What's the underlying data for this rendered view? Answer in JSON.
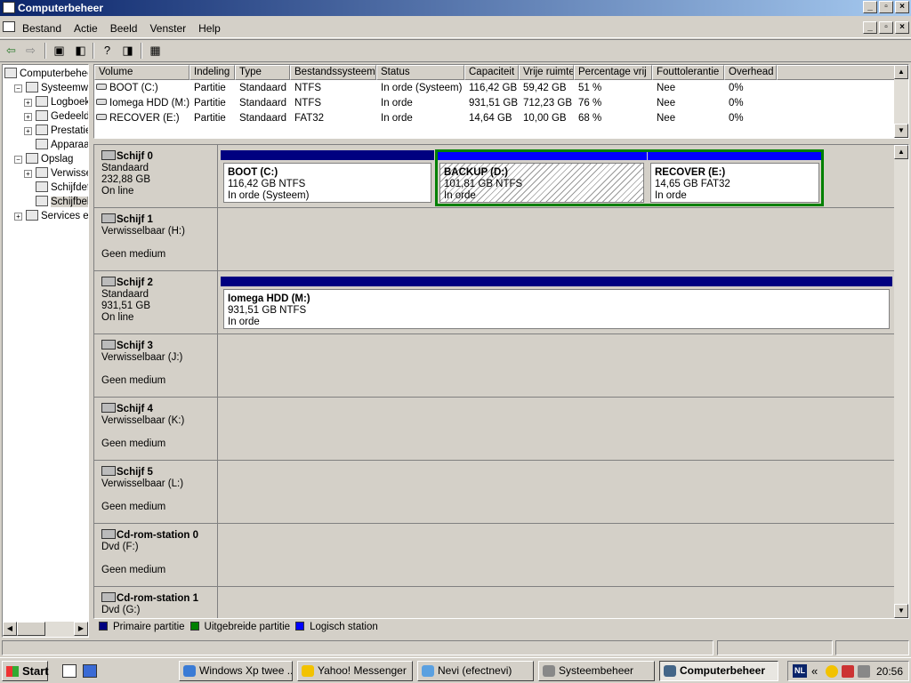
{
  "window": {
    "title": "Computerbeheer"
  },
  "menu": [
    "Bestand",
    "Actie",
    "Beeld",
    "Venster",
    "Help"
  ],
  "tree": [
    {
      "label": "Computerbeheer",
      "indent": 0,
      "pm": ""
    },
    {
      "label": "Systeemwerkset",
      "indent": 1,
      "pm": "−"
    },
    {
      "label": "Logboeken",
      "indent": 2,
      "pm": "+"
    },
    {
      "label": "Gedeelde mappen",
      "indent": 2,
      "pm": "+"
    },
    {
      "label": "Prestaties",
      "indent": 2,
      "pm": "+"
    },
    {
      "label": "Apparaatbeheer",
      "indent": 2,
      "pm": ""
    },
    {
      "label": "Opslag",
      "indent": 1,
      "pm": "−"
    },
    {
      "label": "Verwisselbare opslag",
      "indent": 2,
      "pm": "+"
    },
    {
      "label": "Schijfdefragmentatie",
      "indent": 2,
      "pm": ""
    },
    {
      "label": "Schijfbeheer",
      "indent": 2,
      "pm": "",
      "selected": true
    },
    {
      "label": "Services en toepassingen",
      "indent": 1,
      "pm": "+"
    }
  ],
  "table": {
    "headers": [
      "Volume",
      "Indeling",
      "Type",
      "Bestandssysteem",
      "Status",
      "Capaciteit",
      "Vrije ruimte",
      "Percentage vrij",
      "Fouttolerantie",
      "Overhead"
    ],
    "rows": [
      [
        "BOOT (C:)",
        "Partitie",
        "Standaard",
        "NTFS",
        "In orde (Systeem)",
        "116,42 GB",
        "59,42 GB",
        "51 %",
        "Nee",
        "0%"
      ],
      [
        "Iomega HDD (M:)",
        "Partitie",
        "Standaard",
        "NTFS",
        "In orde",
        "931,51 GB",
        "712,23 GB",
        "76 %",
        "Nee",
        "0%"
      ],
      [
        "RECOVER (E:)",
        "Partitie",
        "Standaard",
        "FAT32",
        "In orde",
        "14,64 GB",
        "10,00 GB",
        "68 %",
        "Nee",
        "0%"
      ]
    ]
  },
  "disks": [
    {
      "name": "Schijf 0",
      "lines": [
        "Standaard",
        "232,88 GB",
        "On line"
      ],
      "partitions": [
        {
          "name": "BOOT  (C:)",
          "size": "116,42 GB NTFS",
          "status": "In orde (Systeem)",
          "kind": "primary"
        },
        {
          "name": "BACKUP  (D:)",
          "size": "101,81 GB NTFS",
          "status": "In orde",
          "kind": "logical",
          "selected": true
        },
        {
          "name": "RECOVER  (E:)",
          "size": "14,65 GB FAT32",
          "status": "In orde",
          "kind": "logical"
        }
      ]
    },
    {
      "name": "Schijf 1",
      "lines": [
        "Verwisselbaar (H:)",
        "",
        "Geen medium"
      ],
      "partitions": []
    },
    {
      "name": "Schijf 2",
      "lines": [
        "Standaard",
        "931,51 GB",
        "On line"
      ],
      "partitions": [
        {
          "name": "Iomega HDD  (M:)",
          "size": "931,51 GB NTFS",
          "status": "In orde",
          "kind": "primary"
        }
      ]
    },
    {
      "name": "Schijf 3",
      "lines": [
        "Verwisselbaar (J:)",
        "",
        "Geen medium"
      ],
      "partitions": []
    },
    {
      "name": "Schijf 4",
      "lines": [
        "Verwisselbaar (K:)",
        "",
        "Geen medium"
      ],
      "partitions": []
    },
    {
      "name": "Schijf 5",
      "lines": [
        "Verwisselbaar (L:)",
        "",
        "Geen medium"
      ],
      "partitions": []
    },
    {
      "name": "Cd-rom-station 0",
      "lines": [
        "Dvd (F:)",
        "",
        "Geen medium"
      ],
      "partitions": []
    },
    {
      "name": "Cd-rom-station 1",
      "lines": [
        "Dvd (G:)",
        "",
        ""
      ],
      "partitions": []
    }
  ],
  "legend": [
    {
      "label": "Primaire partitie",
      "color": "#000080"
    },
    {
      "label": "Uitgebreide partitie",
      "color": "#008000"
    },
    {
      "label": "Logisch station",
      "color": "#0000ff"
    }
  ],
  "taskbar": {
    "start": "Start",
    "tasks": [
      {
        "label": "Windows Xp twee ...",
        "icon": "browser-icon",
        "color": "#3a7bd5"
      },
      {
        "label": "Yahoo! Messenger",
        "icon": "smiley-icon",
        "color": "#f2c200"
      },
      {
        "label": "Nevi (efectnevi)",
        "icon": "chat-icon",
        "color": "#5aa0e0"
      },
      {
        "label": "Systeembeheer",
        "icon": "tools-icon",
        "color": "#888888"
      },
      {
        "label": "Computerbeheer",
        "icon": "computer-icon",
        "color": "#446688",
        "active": true
      }
    ],
    "lang": "NL",
    "chevron": "«",
    "clock": "20:56"
  }
}
